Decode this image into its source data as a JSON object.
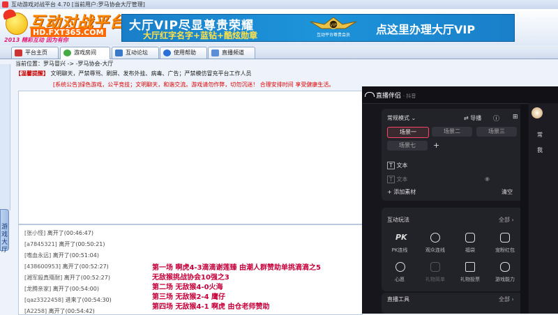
{
  "window": {
    "title": "互动游戏对战平台 4.70 [当前用户:罗马协会大厅管理]"
  },
  "logo": {
    "main": "互动对战平台",
    "site": "HD.FXT365.COM",
    "slogan": "2013 精彩互动 因为有你"
  },
  "banner": {
    "line1": "大厅VIP尽显尊贵荣耀",
    "line2": "大厅红字名字+蓝钻+酷炫勋章",
    "cta": "点这里办理大厅VIP",
    "emblem_caption": "互动平台尊贵会员"
  },
  "nav": {
    "tabs": [
      {
        "label": "平台主页",
        "icon": "home-icon"
      },
      {
        "label": "游戏房间",
        "icon": "game-room-icon"
      },
      {
        "label": "互动论坛",
        "icon": "forum-icon"
      },
      {
        "label": "使用帮助",
        "icon": "help-icon"
      },
      {
        "label": "直播频道",
        "icon": "live-icon"
      }
    ]
  },
  "location": "当前位置：罗马冒兴 -> -罗马协会-大厅",
  "notice": {
    "head": "【温馨提醒】",
    "text": "文明聊天，严禁辱骂、刷屏、发布外挂、病毒、广告；严禁模仿冒充平台工作人员"
  },
  "system_message": "[系统公告]绿色游戏，公平竞技；文明聊天，和谐交流。游戏请勿作弊，切勿沉迷！ 合理安排时间 享受健康生活。",
  "sidebar": {
    "tab_label": "游戏大厅"
  },
  "chat_list": [
    {
      "name": "[张小怪]",
      "action": "离开了",
      "time": "(00:46:47)"
    },
    {
      "name": "[a7845321]",
      "action": "离开了",
      "time": "(00:50:21)"
    },
    {
      "name": "[嗜血永远]",
      "action": "离开了",
      "time": "(00:51:04)"
    },
    {
      "name": "[438600953]",
      "action": "离开了",
      "time": "(00:52:27)"
    },
    {
      "name": "[湘军殺真殤耐]",
      "action": "离开了",
      "time": "(00:52:27)"
    },
    {
      "name": "[龙腾亲家]",
      "action": "离开了",
      "time": "(00:54:00)"
    },
    {
      "name": "[qaz3322458]",
      "action": "进来了",
      "time": "(00:54:30)"
    },
    {
      "name": "[A2258]",
      "action": "离开了",
      "time": "(00:54:42)"
    }
  ],
  "overlay_lines": [
    "第一场  啊虎4-3滴滴谢莲臻  由潮人群赞助单挑滴滴之5",
    "无敌猴挑战协会10强之3",
    "第二场 无敌猴4-0火海",
    "第三场 无敌猴2-4 鹰仔",
    "第四场 无敌猴4-1 啊虎        由仓老师赞助"
  ],
  "stream_app": {
    "brand": "直播伴侣",
    "sub": "· 抖音",
    "mode": "常规模式",
    "guide": "导播",
    "scenes": [
      "场景一",
      "场景二",
      "场景三",
      "场景七"
    ],
    "source_text": "文本",
    "source_text2": "文本",
    "add_material": "添加素材",
    "clear": "清空",
    "interactive_title": "互动玩法",
    "all": "全部",
    "grid": [
      "PK连线",
      "观众连线",
      "福袋",
      "宠粉红包",
      "心愿",
      "礼物简单",
      "礼物投票",
      "游戏能力"
    ],
    "tools_title": "直播工具",
    "right_labels": [
      "常",
      "我"
    ]
  },
  "colors": {
    "accent_red": "#c5003a",
    "banner_blue": "#1a7fc9",
    "stream_bg": "#16161c"
  }
}
